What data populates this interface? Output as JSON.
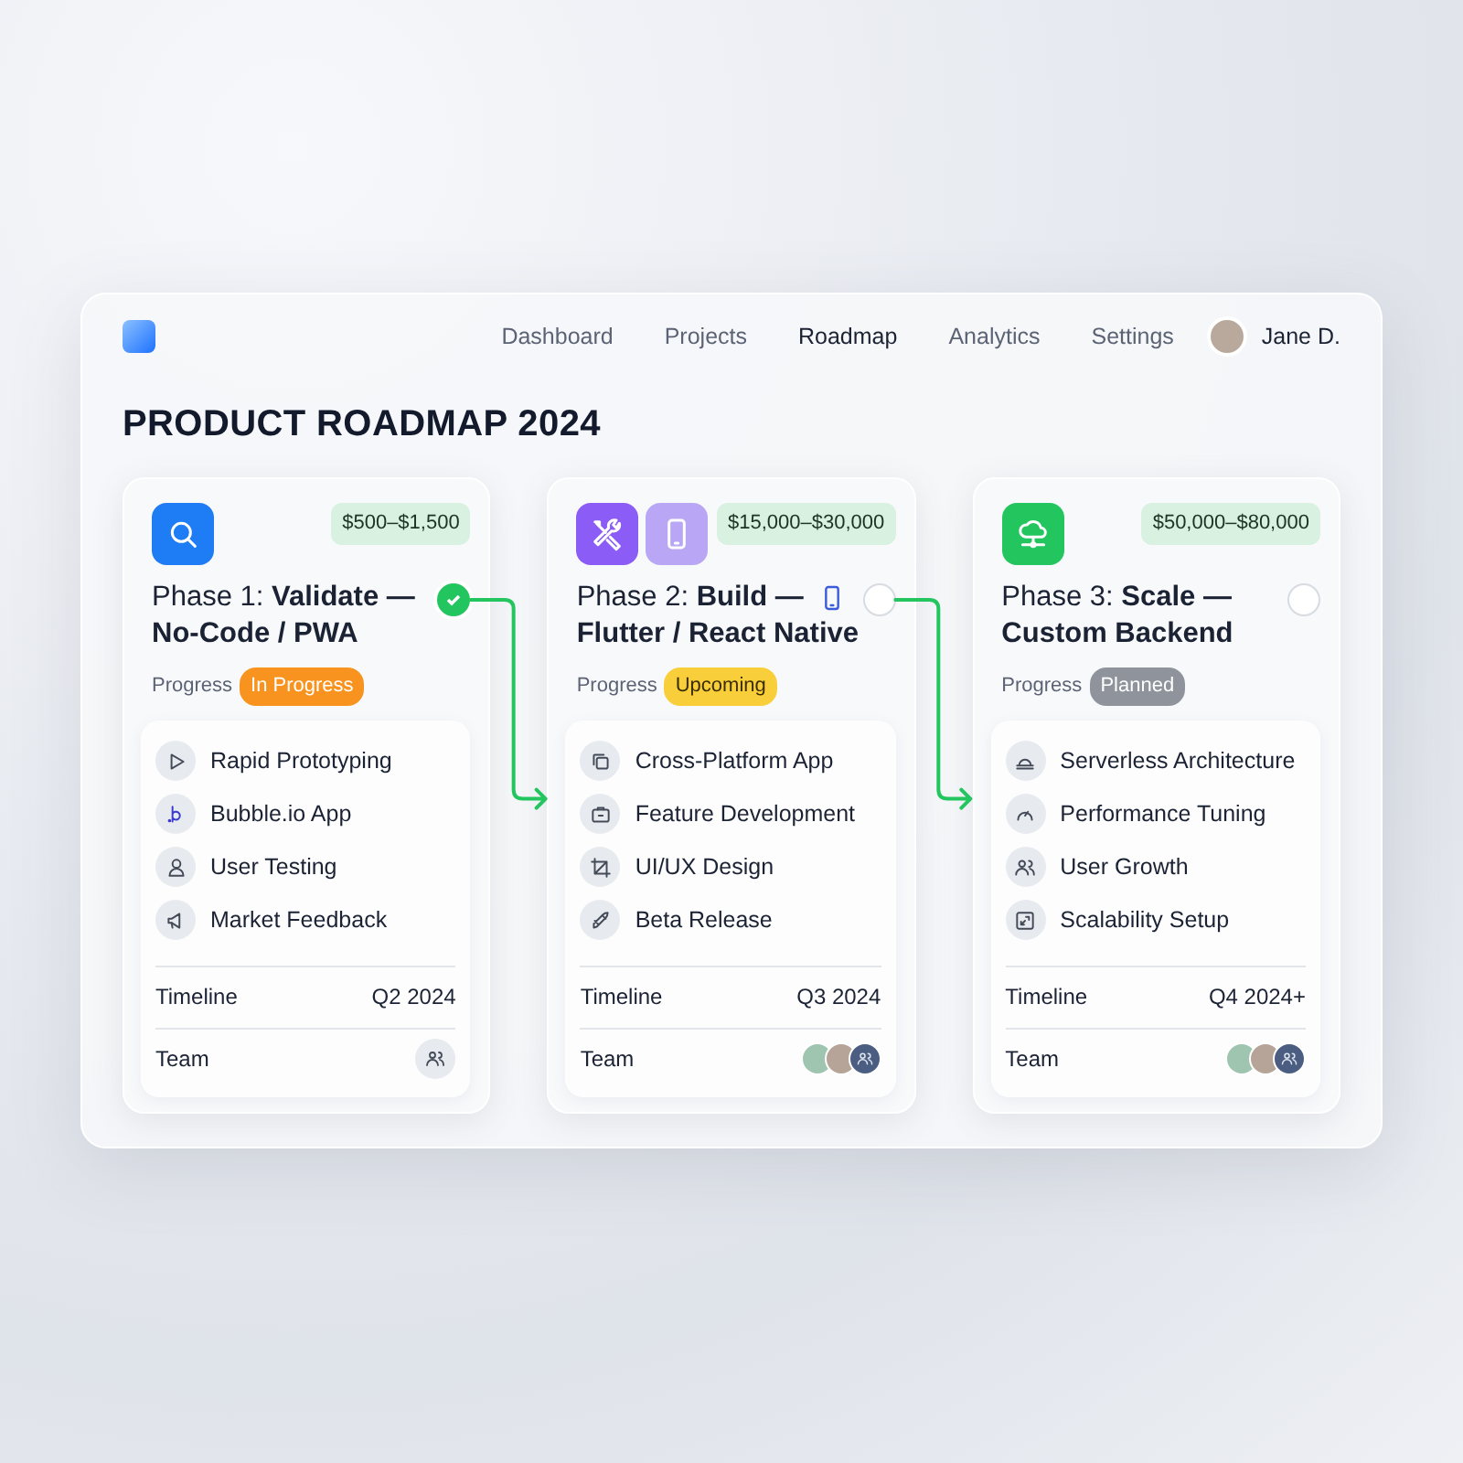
{
  "nav": {
    "links": [
      {
        "label": "Dashboard",
        "selected": false
      },
      {
        "label": "Projects",
        "selected": false
      },
      {
        "label": "Roadmap",
        "selected": true
      },
      {
        "label": "Analytics",
        "selected": false
      },
      {
        "label": "Settings",
        "selected": false
      }
    ],
    "user": {
      "name": "Jane D."
    }
  },
  "title": "PRODUCT ROADMAP 2024",
  "phases": [
    {
      "price": "$500–$1,500",
      "title": "Phase 1: **Validate —**",
      "subtitle": "No-Code / PWA",
      "done": true,
      "progress_label": "Progress",
      "status": {
        "label": "In Progress",
        "kind": "in_progress"
      },
      "features": [
        {
          "label": "Rapid Prototyping"
        },
        {
          "label": "Bubble.io App"
        },
        {
          "label": "User Testing"
        },
        {
          "label": "Market Feedback"
        }
      ],
      "timeline_label": "Timeline",
      "timeline": "Q2 2024",
      "team_label": "Team"
    },
    {
      "price": "$15,000–$30,000",
      "title": "Phase 2: **Build —**",
      "subtitle": "Flutter / React Native",
      "done": false,
      "progress_label": "Progress",
      "status": {
        "label": "Upcoming",
        "kind": "upcoming"
      },
      "features": [
        {
          "label": "Cross-Platform App"
        },
        {
          "label": "Feature Development"
        },
        {
          "label": "UI/UX Design"
        },
        {
          "label": "Beta Release"
        }
      ],
      "timeline_label": "Timeline",
      "timeline": "Q3 2024",
      "team_label": "Team"
    },
    {
      "price": "$50,000–$80,000",
      "title": "Phase 3: **Scale —**",
      "subtitle": "Custom Backend",
      "done": false,
      "progress_label": "Progress",
      "status": {
        "label": "Planned",
        "kind": "planned"
      },
      "features": [
        {
          "label": "Serverless Architecture"
        },
        {
          "label": "Performance Tuning"
        },
        {
          "label": "User Growth"
        },
        {
          "label": "Scalability Setup"
        }
      ],
      "timeline_label": "Timeline",
      "timeline": "Q4 2024+",
      "team_label": "Team"
    }
  ]
}
